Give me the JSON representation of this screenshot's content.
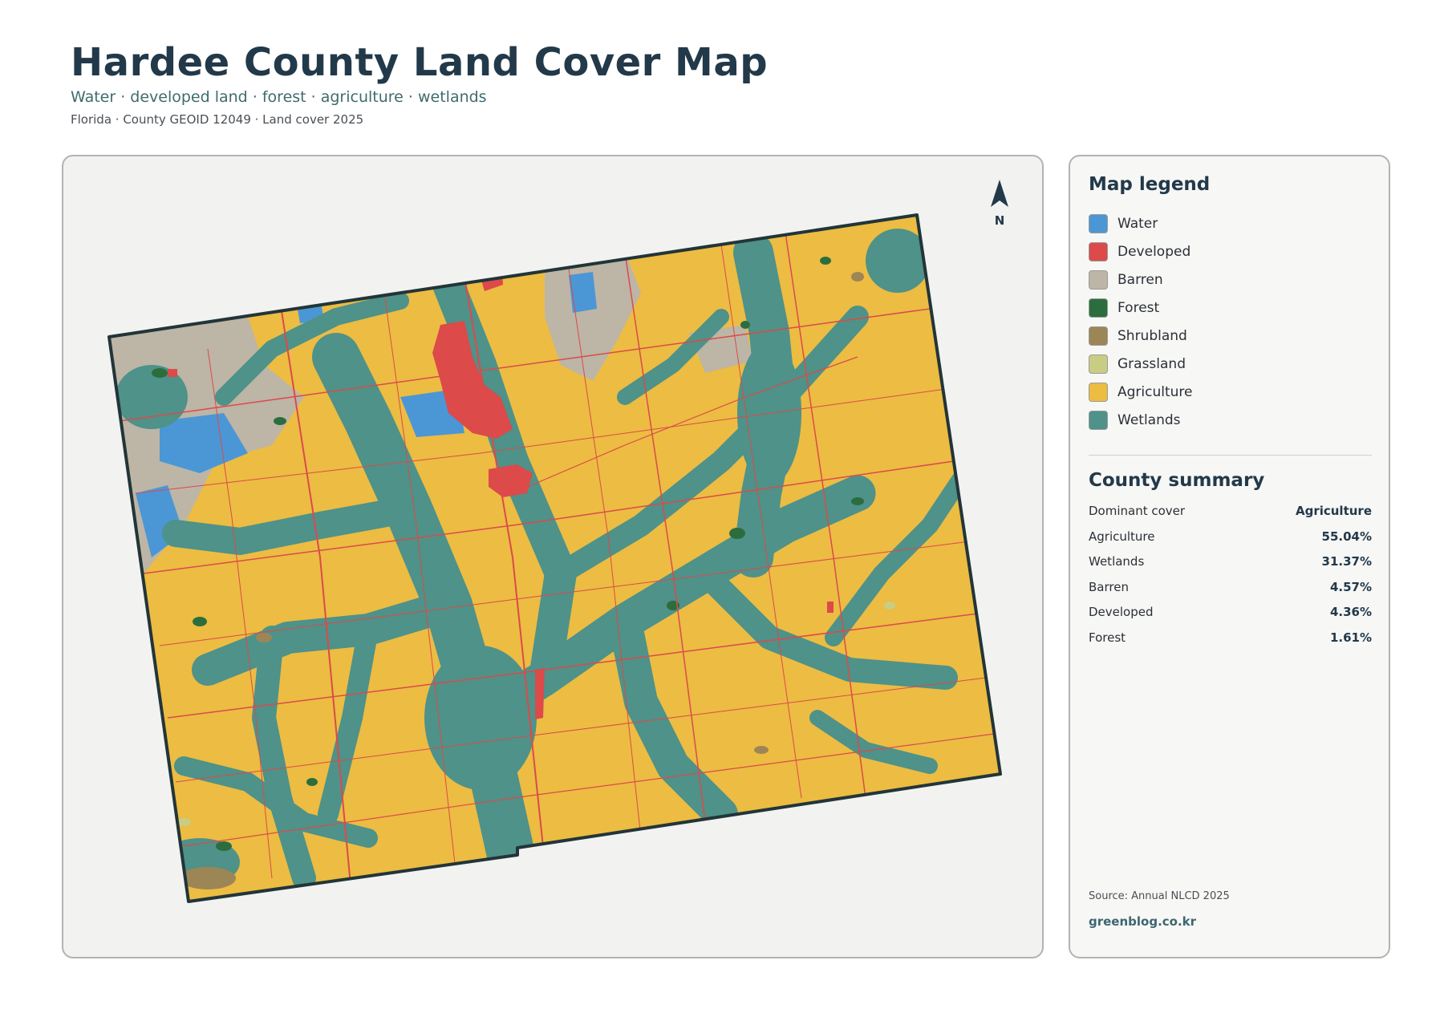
{
  "header": {
    "title": "Hardee County Land Cover Map",
    "subtitle": "Water · developed land · forest · agriculture · wetlands",
    "meta": "Florida · County GEOID 12049 · Land cover 2025"
  },
  "map": {
    "north_label": "N",
    "colors": {
      "water": "#4b97d6",
      "developed": "#dc4a4a",
      "barren": "#bdb5a6",
      "forest": "#2c6d3e",
      "shrubland": "#9c8656",
      "grassland": "#c9cd84",
      "agriculture": "#ecbc43",
      "wetlands": "#4e9289",
      "boundary": "#223538"
    }
  },
  "legend": {
    "title": "Map legend",
    "items": [
      {
        "label": "Water",
        "color": "#4b97d6"
      },
      {
        "label": "Developed",
        "color": "#dc4a4a"
      },
      {
        "label": "Barren",
        "color": "#bdb5a6"
      },
      {
        "label": "Forest",
        "color": "#2c6d3e"
      },
      {
        "label": "Shrubland",
        "color": "#9c8656"
      },
      {
        "label": "Grassland",
        "color": "#c9cd84"
      },
      {
        "label": "Agriculture",
        "color": "#ecbc43"
      },
      {
        "label": "Wetlands",
        "color": "#4e9289"
      }
    ]
  },
  "summary": {
    "title": "County summary",
    "rows": [
      {
        "label": "Dominant cover",
        "value": "Agriculture"
      },
      {
        "label": "Agriculture",
        "value": "55.04%"
      },
      {
        "label": "Wetlands",
        "value": "31.37%"
      },
      {
        "label": "Barren",
        "value": "4.57%"
      },
      {
        "label": "Developed",
        "value": "4.36%"
      },
      {
        "label": "Forest",
        "value": "1.61%"
      }
    ]
  },
  "footer": {
    "source": "Source: Annual NLCD 2025",
    "site": "greenblog.co.kr"
  }
}
